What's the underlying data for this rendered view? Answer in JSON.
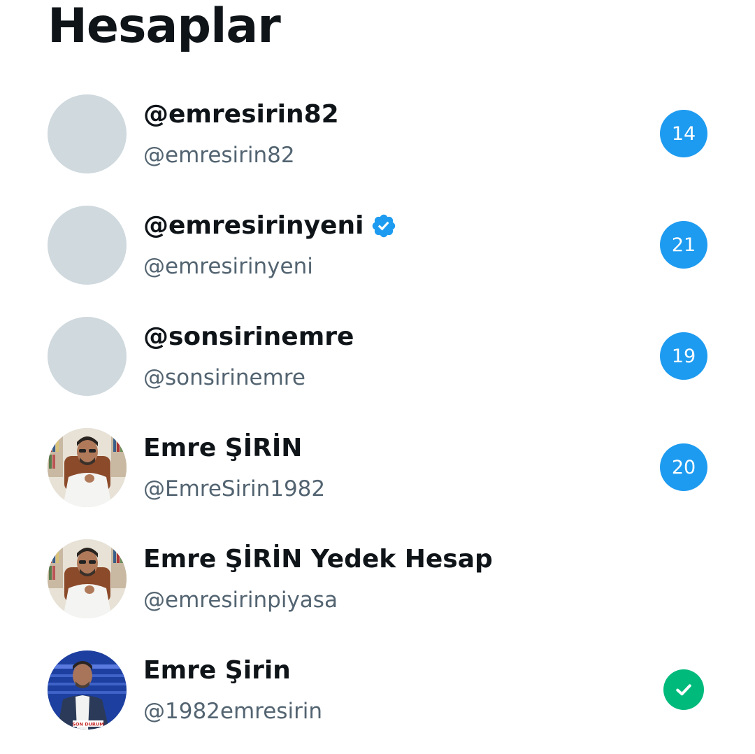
{
  "header": {
    "title": "Hesaplar"
  },
  "accounts": [
    {
      "name": "@emresirin82",
      "handle": "@emresirin82",
      "unread": "14",
      "verified": false,
      "avatar": "blank-avatar"
    },
    {
      "name": "@emresirinyeni",
      "handle": "@emresirinyeni",
      "unread": "21",
      "verified": true,
      "avatar": "blank-avatar"
    },
    {
      "name": "@sonsirinemre",
      "handle": "@sonsirinemre",
      "unread": "19",
      "verified": false,
      "avatar": "blank-avatar"
    },
    {
      "name": "Emre ŞİRİN",
      "handle": "@EmreSirin1982",
      "unread": "20",
      "verified": false,
      "avatar": "profile-photo-studio"
    },
    {
      "name": "Emre ŞİRİN Yedek Hesap",
      "handle": "@emresirinpiyasa",
      "unread": "",
      "verified": false,
      "avatar": "profile-photo-studio"
    },
    {
      "name": "Emre Şirin",
      "handle": "@1982emresirin",
      "unread": "",
      "verified": false,
      "active": true,
      "avatar": "profile-photo-tv"
    }
  ],
  "colors": {
    "accent": "#1d9bf0",
    "active_check": "#00ba7c",
    "avatar_placeholder": "#cfd9de",
    "secondary_text": "#536471"
  },
  "avatar_caption": "SON DURUM"
}
